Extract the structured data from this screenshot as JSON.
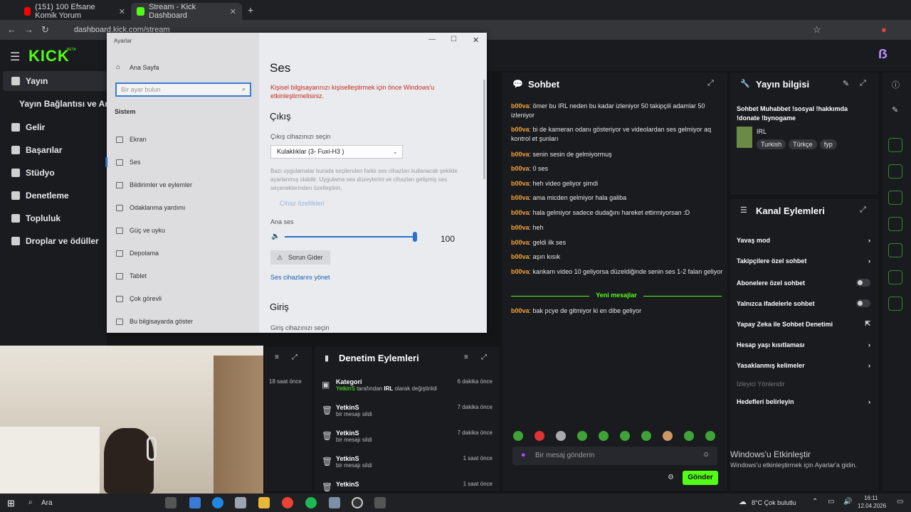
{
  "browser": {
    "tabs": [
      {
        "title": "(151) 100 Efsane Komik Yorum",
        "active": false
      },
      {
        "title": "Stream - Kick Dashboard",
        "active": true
      }
    ],
    "url": "dashboard.kick.com/stream"
  },
  "kick": {
    "logo": "KICK",
    "beta": "BETA"
  },
  "sidebar": {
    "items": [
      {
        "label": "Yayın"
      },
      {
        "label": "Yayın Bağlantısı ve Anah"
      },
      {
        "label": "Gelir"
      },
      {
        "label": "Başarılar"
      },
      {
        "label": "Stüdyo"
      },
      {
        "label": "Denetleme"
      },
      {
        "label": "Topluluk"
      },
      {
        "label": "Droplar ve ödüller"
      }
    ]
  },
  "chat": {
    "title": "Sohbet",
    "messages": [
      {
        "user": "b00va",
        "text": "ömer bu IRL neden bu kadar izleniyor 50 takipçili adamlar 50 izleniyor"
      },
      {
        "user": "b00va",
        "text": "bi de kameran odanı gösteriyor ve videolardan ses gelmiyor aq kontrol et şunları"
      },
      {
        "user": "b00va",
        "text": "senin sesin de gelmiyormuş"
      },
      {
        "user": "b00va",
        "text": "0 ses"
      },
      {
        "user": "b00va",
        "text": "heh video geliyor şimdi"
      },
      {
        "user": "b00va",
        "text": "ama micden gelmiyor hala galiba"
      },
      {
        "user": "b00va",
        "text": "hala gelmiyor sadece dudağını hareket ettirmiyorsan :D"
      },
      {
        "user": "b00va",
        "text": "heh"
      },
      {
        "user": "b00va",
        "text": "geldi ilk ses"
      },
      {
        "user": "b00va",
        "text": "aşırı kısık"
      },
      {
        "user": "b00va",
        "text": "kankam video 10 geliyorsa düzeldiğinde senin ses 1-2 falan geliyor"
      }
    ],
    "new_messages_label": "Yeni mesajlar",
    "after": [
      {
        "user": "b00va",
        "text": "bak pcye de gitmiyor ki en dibe geliyor"
      }
    ],
    "placeholder": "Bir mesaj gönderin",
    "send": "Gönder"
  },
  "stream_info": {
    "title": "Yayın bilgisi",
    "stream_title": "Sohbet Muhabbet !sosyal !hakkımda !donate !bynogame",
    "category": "IRL",
    "tags": [
      "Turkish",
      "Türkçe",
      "fyp"
    ]
  },
  "channel_actions": {
    "title": "Kanal Eylemleri",
    "items": [
      {
        "label": "Yavaş mod",
        "kind": "chevron"
      },
      {
        "label": "Takipçilere özel sohbet",
        "kind": "chevron"
      },
      {
        "label": "Abonelere özel sohbet",
        "kind": "toggle"
      },
      {
        "label": "Yalnızca ifadelerle sohbet",
        "kind": "toggle"
      },
      {
        "label": "Yapay Zeka ile Sohbet Denetimi",
        "kind": "external"
      },
      {
        "label": "Hesap yaşı kısıtlaması",
        "kind": "chevron"
      },
      {
        "label": "Yasaklanmış kelimeler",
        "kind": "chevron"
      }
    ],
    "raid_label": "İzleyici Yönlendir",
    "raid_item": "Hedefleri belirleyin"
  },
  "mod_actions": {
    "title": "Denetim Eylemleri",
    "left_time": "18 saat önce",
    "rows": [
      {
        "name": "Kategori",
        "sub_user": "YetkinS",
        "sub_mid": "tarafından",
        "sub_val": "IRL",
        "sub_end": "olarak değiştirildi",
        "time": "6 dakika önce"
      },
      {
        "name": "YetkinS",
        "sub": "bir mesajı sildi",
        "time": "7 dakika önce"
      },
      {
        "name": "YetkinS",
        "sub": "bir mesajı sildi",
        "time": "7 dakika önce"
      },
      {
        "name": "YetkinS",
        "sub": "bir mesajı sildi",
        "time": "1 saat önce"
      },
      {
        "name": "YetkinS",
        "sub": "",
        "time": "1 saat önce"
      }
    ]
  },
  "settings": {
    "window_title": "Ayarlar",
    "home": "Ana Sayfa",
    "search_placeholder": "Bir ayar bulun",
    "category": "Sistem",
    "items": [
      "Ekran",
      "Ses",
      "Bildirimler ve eylemler",
      "Odaklanma yardımı",
      "Güç ve uyku",
      "Depolama",
      "Tablet",
      "Çok görevli",
      "Bu bilgisayarda göster"
    ],
    "page_title": "Ses",
    "warning": "Kişisel bilgisayarınızı kişiselleştirmek için önce Windows'u etkinleştirmelisiniz.",
    "output_h": "Çıkış",
    "output_label": "Çıkış cihazınızı seçin",
    "output_device": "Kulaklıklar (3- Fuxi-H3 )",
    "note": "Bazı uygulamalar burada seçilenden farklı ses cihazları kullanacak şekilde ayarlanmış olabilir. Uygulama ses düzeylerini ve cihazları gelişmiş ses seçeneklerinden özelleştirin.",
    "device_props": "Cihaz özellikleri",
    "master": "Ana ses",
    "volume": "100",
    "troubleshoot": "Sorun Gider",
    "manage": "Ses cihazlarını yönet",
    "input_h": "Giriş",
    "input_label": "Giriş cihazınızı seçin"
  },
  "watermark": {
    "line1": "Windows'u Etkinleştir",
    "line2": "Windows'u etkinleştirmek için Ayarlar'a gidin."
  },
  "taskbar": {
    "search": "Ara",
    "weather": "8°C  Çok bulutlu",
    "time": "16:11",
    "date": "12.04.2026"
  }
}
